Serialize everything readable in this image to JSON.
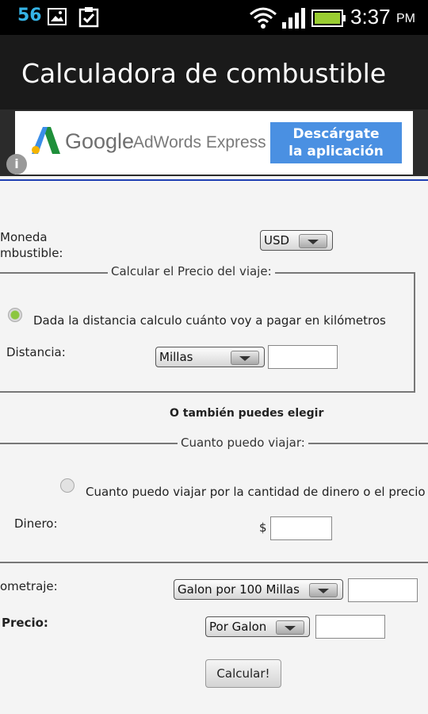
{
  "status_bar": {
    "notification_count": "56",
    "time": "3:37",
    "ampm": "PM",
    "icons": [
      "image-icon",
      "clipboard-check-icon",
      "wifi-icon",
      "signal-icon",
      "battery-icon"
    ]
  },
  "app": {
    "title": "Calculadora de combustible"
  },
  "ad": {
    "brand": "Google",
    "product": "AdWords Express",
    "cta_line1": "Descárgate",
    "cta_line2": "la aplicación",
    "info": "i"
  },
  "form": {
    "moneda_label_line1": "Moneda",
    "moneda_label_line2": "mbustible:",
    "currency_select": "USD",
    "section1": {
      "legend": "Calcular el Precio del viaje:",
      "radio_label": "Dada la distancia calculo cuánto voy a pagar en kilómetros",
      "radio_checked": true,
      "distance_label": "Distancia:",
      "distance_unit_select": "Millas",
      "distance_value": ""
    },
    "or_text": "O también puedes elegir",
    "section2": {
      "legend": "Cuanto puedo viajar:",
      "radio_label": "Cuanto puedo viajar por la cantidad de dinero o el precio .",
      "radio_checked": false,
      "money_label": "Dinero:",
      "currency_symbol": "$",
      "money_value": ""
    },
    "mileage_label": "ometraje:",
    "mileage_select": "Galon por 100 Millas",
    "mileage_value": "",
    "price_label": "Precio:",
    "price_select": "Por Galon",
    "price_value": "",
    "calculate_button": "Calcular!"
  },
  "colors": {
    "accent_blue": "#35b3e5",
    "ad_button": "#4a90e2",
    "radio_green": "#8cc63f"
  }
}
